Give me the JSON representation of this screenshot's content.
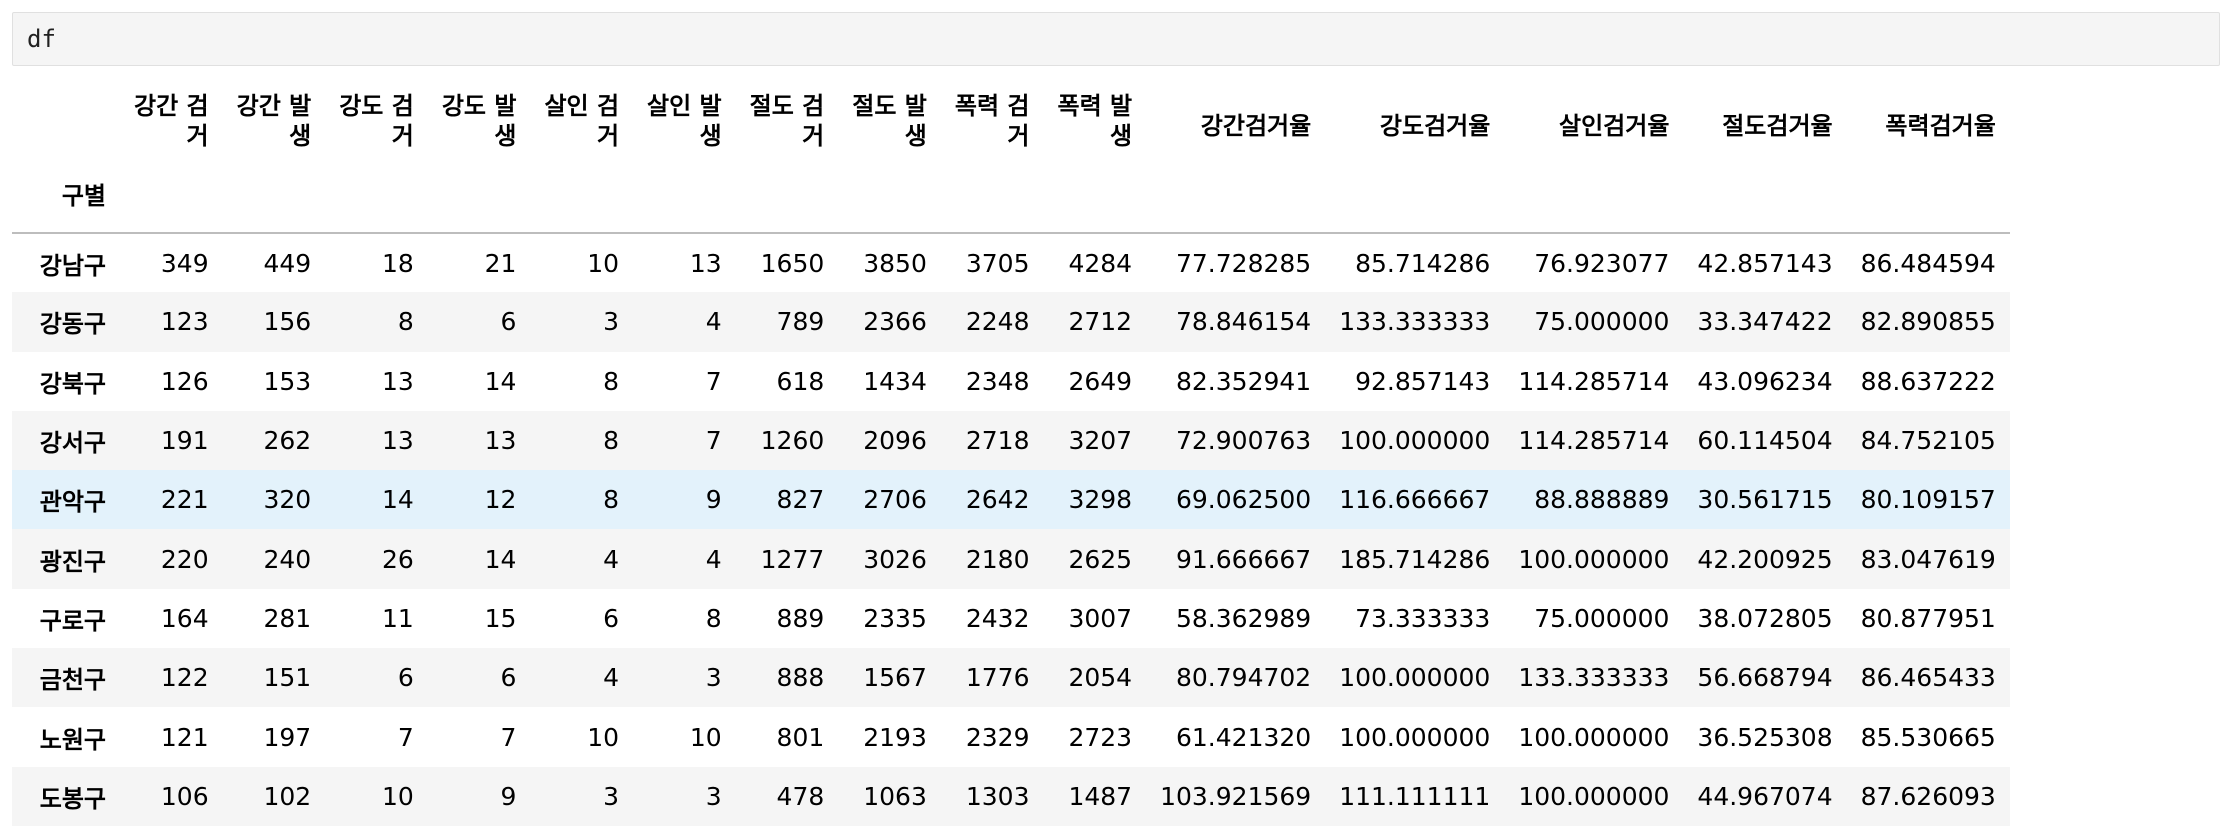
{
  "code_cell": {
    "source": "df"
  },
  "table": {
    "index_name": "구별",
    "columns": [
      [
        "강간 검",
        "거"
      ],
      [
        "강간 발",
        "생"
      ],
      [
        "강도 검",
        "거"
      ],
      [
        "강도 발",
        "생"
      ],
      [
        "살인 검",
        "거"
      ],
      [
        "살인 발",
        "생"
      ],
      [
        "절도 검",
        "거"
      ],
      [
        "절도 발",
        "생"
      ],
      [
        "폭력 검",
        "거"
      ],
      [
        "폭력 발",
        "생"
      ],
      [
        "강간검거율"
      ],
      [
        "강도검거율"
      ],
      [
        "살인검거율"
      ],
      [
        "절도검거율"
      ],
      [
        "폭력검거율"
      ]
    ],
    "rows": [
      {
        "index": "강남구",
        "values": [
          "349",
          "449",
          "18",
          "21",
          "10",
          "13",
          "1650",
          "3850",
          "3705",
          "4284",
          "77.728285",
          "85.714286",
          "76.923077",
          "42.857143",
          "86.484594"
        ]
      },
      {
        "index": "강동구",
        "values": [
          "123",
          "156",
          "8",
          "6",
          "3",
          "4",
          "789",
          "2366",
          "2248",
          "2712",
          "78.846154",
          "133.333333",
          "75.000000",
          "33.347422",
          "82.890855"
        ]
      },
      {
        "index": "강북구",
        "values": [
          "126",
          "153",
          "13",
          "14",
          "8",
          "7",
          "618",
          "1434",
          "2348",
          "2649",
          "82.352941",
          "92.857143",
          "114.285714",
          "43.096234",
          "88.637222"
        ]
      },
      {
        "index": "강서구",
        "values": [
          "191",
          "262",
          "13",
          "13",
          "8",
          "7",
          "1260",
          "2096",
          "2718",
          "3207",
          "72.900763",
          "100.000000",
          "114.285714",
          "60.114504",
          "84.752105"
        ]
      },
      {
        "index": "관악구",
        "values": [
          "221",
          "320",
          "14",
          "12",
          "8",
          "9",
          "827",
          "2706",
          "2642",
          "3298",
          "69.062500",
          "116.666667",
          "88.888889",
          "30.561715",
          "80.109157"
        ],
        "highlighted": true
      },
      {
        "index": "광진구",
        "values": [
          "220",
          "240",
          "26",
          "14",
          "4",
          "4",
          "1277",
          "3026",
          "2180",
          "2625",
          "91.666667",
          "185.714286",
          "100.000000",
          "42.200925",
          "83.047619"
        ]
      },
      {
        "index": "구로구",
        "values": [
          "164",
          "281",
          "11",
          "15",
          "6",
          "8",
          "889",
          "2335",
          "2432",
          "3007",
          "58.362989",
          "73.333333",
          "75.000000",
          "38.072805",
          "80.877951"
        ]
      },
      {
        "index": "금천구",
        "values": [
          "122",
          "151",
          "6",
          "6",
          "4",
          "3",
          "888",
          "1567",
          "1776",
          "2054",
          "80.794702",
          "100.000000",
          "133.333333",
          "56.668794",
          "86.465433"
        ]
      },
      {
        "index": "노원구",
        "values": [
          "121",
          "197",
          "7",
          "7",
          "10",
          "10",
          "801",
          "2193",
          "2329",
          "2723",
          "61.421320",
          "100.000000",
          "100.000000",
          "36.525308",
          "85.530665"
        ]
      },
      {
        "index": "도봉구",
        "values": [
          "106",
          "102",
          "10",
          "9",
          "3",
          "3",
          "478",
          "1063",
          "1303",
          "1487",
          "103.921569",
          "111.111111",
          "100.000000",
          "44.967074",
          "87.626093"
        ]
      }
    ]
  },
  "colors": {
    "code_bg": "#f5f5f5",
    "stripe": "#f5f5f5",
    "hover": "#e3f2fb",
    "header_rule": "#bdbdbd"
  }
}
